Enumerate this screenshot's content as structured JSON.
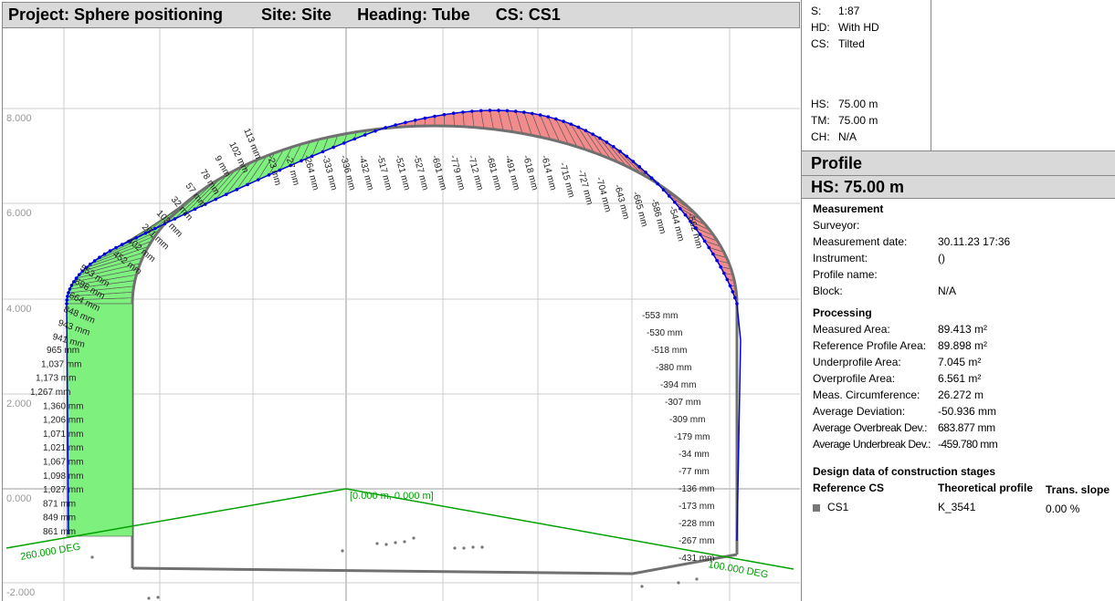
{
  "title_bar": {
    "project": "Project: Sphere positioning",
    "site": "Site: Site",
    "heading": "Heading: Tube",
    "cs": "CS: CS1"
  },
  "plot": {
    "y_ticks": [
      "8.000",
      "6.000",
      "4.000",
      "2.000",
      "0.000",
      "-2.000"
    ],
    "origin_label": "[0.000 m, 0.000 m]",
    "left_angle": "260.000 DEG",
    "right_angle": "100.000 DEG",
    "colors": {
      "underprofile": "#7ef07e",
      "overprofile": "#f28b8b",
      "measured": "#0000dd",
      "reference": "#707070",
      "axis": "#00a000",
      "grid": "#cccccc"
    },
    "left_deviations": [
      "861 mm",
      "849 mm",
      "871 mm",
      "1,027 mm",
      "1,098 mm",
      "1,067 mm",
      "1,021 mm",
      "1,071 mm",
      "1,206 mm",
      "1,360 mm",
      "1,267 mm",
      "1,173 mm",
      "1,037 mm",
      "965 mm",
      "941 mm",
      "943 mm",
      "848 mm",
      "664 mm",
      "696 mm",
      "553 mm",
      "452 mm",
      "402 mm",
      "261 mm",
      "103 mm",
      "32 mm",
      "57 mm",
      "78 mm",
      "9 mm",
      "102 mm",
      "113 mm"
    ],
    "crown_deviations": [
      "-23 mm",
      "-27 mm",
      "-264 mm",
      "-333 mm",
      "-336 mm",
      "-432 mm",
      "-517 mm",
      "-521 mm",
      "-527 mm",
      "-691 mm",
      "-779 mm",
      "-712 mm",
      "-681 mm",
      "-491 mm",
      "-618 mm",
      "-614 mm",
      "-715 mm",
      "-727 mm",
      "-704 mm",
      "-643 mm",
      "-665 mm",
      "-586 mm",
      "-544 mm",
      "-562 mm"
    ],
    "right_deviations": [
      "-553 mm",
      "-530 mm",
      "-518 mm",
      "-380 mm",
      "-394 mm",
      "-307 mm",
      "-309 mm",
      "-179 mm",
      "-34 mm",
      "-77 mm",
      "-136 mm",
      "-173 mm",
      "-228 mm",
      "-267 mm",
      "-431 mm"
    ]
  },
  "info": {
    "scale_key": "S:",
    "scale_val": "1:87",
    "hd_key": "HD:",
    "hd_val": "With HD",
    "cs_key": "CS:",
    "cs_val": "Tilted",
    "hs_key": "HS:",
    "hs_val": "75.00 m",
    "tm_key": "TM:",
    "tm_val": "75.00 m",
    "ch_key": "CH:",
    "ch_val": "N/A"
  },
  "profile": {
    "header": "Profile",
    "hs_header": "HS: 75.00 m",
    "measurement": {
      "title": "Measurement",
      "surveyor_label": "Surveyor:",
      "surveyor_value": "",
      "date_label": "Measurement date:",
      "date_value": "30.11.23 17:36",
      "instrument_label": "Instrument:",
      "instrument_value": "()",
      "profile_name_label": "Profile name:",
      "profile_name_value": "",
      "block_label": "Block:",
      "block_value": "N/A"
    },
    "processing": {
      "title": "Processing",
      "rows": [
        {
          "label": "Measured Area:",
          "value": "89.413 m²"
        },
        {
          "label": "Reference Profile Area:",
          "value": "89.898 m²"
        },
        {
          "label": "Underprofile Area:",
          "value": "7.045 m²"
        },
        {
          "label": "Overprofile Area:",
          "value": "6.561 m²"
        },
        {
          "label": "Meas. Circumference:",
          "value": "26.272 m"
        },
        {
          "label": "Average Deviation:",
          "value": "-50.936 mm"
        },
        {
          "label": "Average Overbreak Dev.:",
          "value": "683.877 mm"
        },
        {
          "label": "Average Underbreak Dev.:",
          "value": "-459.780 mm"
        }
      ]
    },
    "design": {
      "title": "Design data of construction stages",
      "col_ref": "Reference CS",
      "col_theo": "Theoretical profile",
      "col_slope": "Trans. slope",
      "row_ref": "CS1",
      "row_theo": "K_3541",
      "row_slope": "0.00 %"
    }
  }
}
